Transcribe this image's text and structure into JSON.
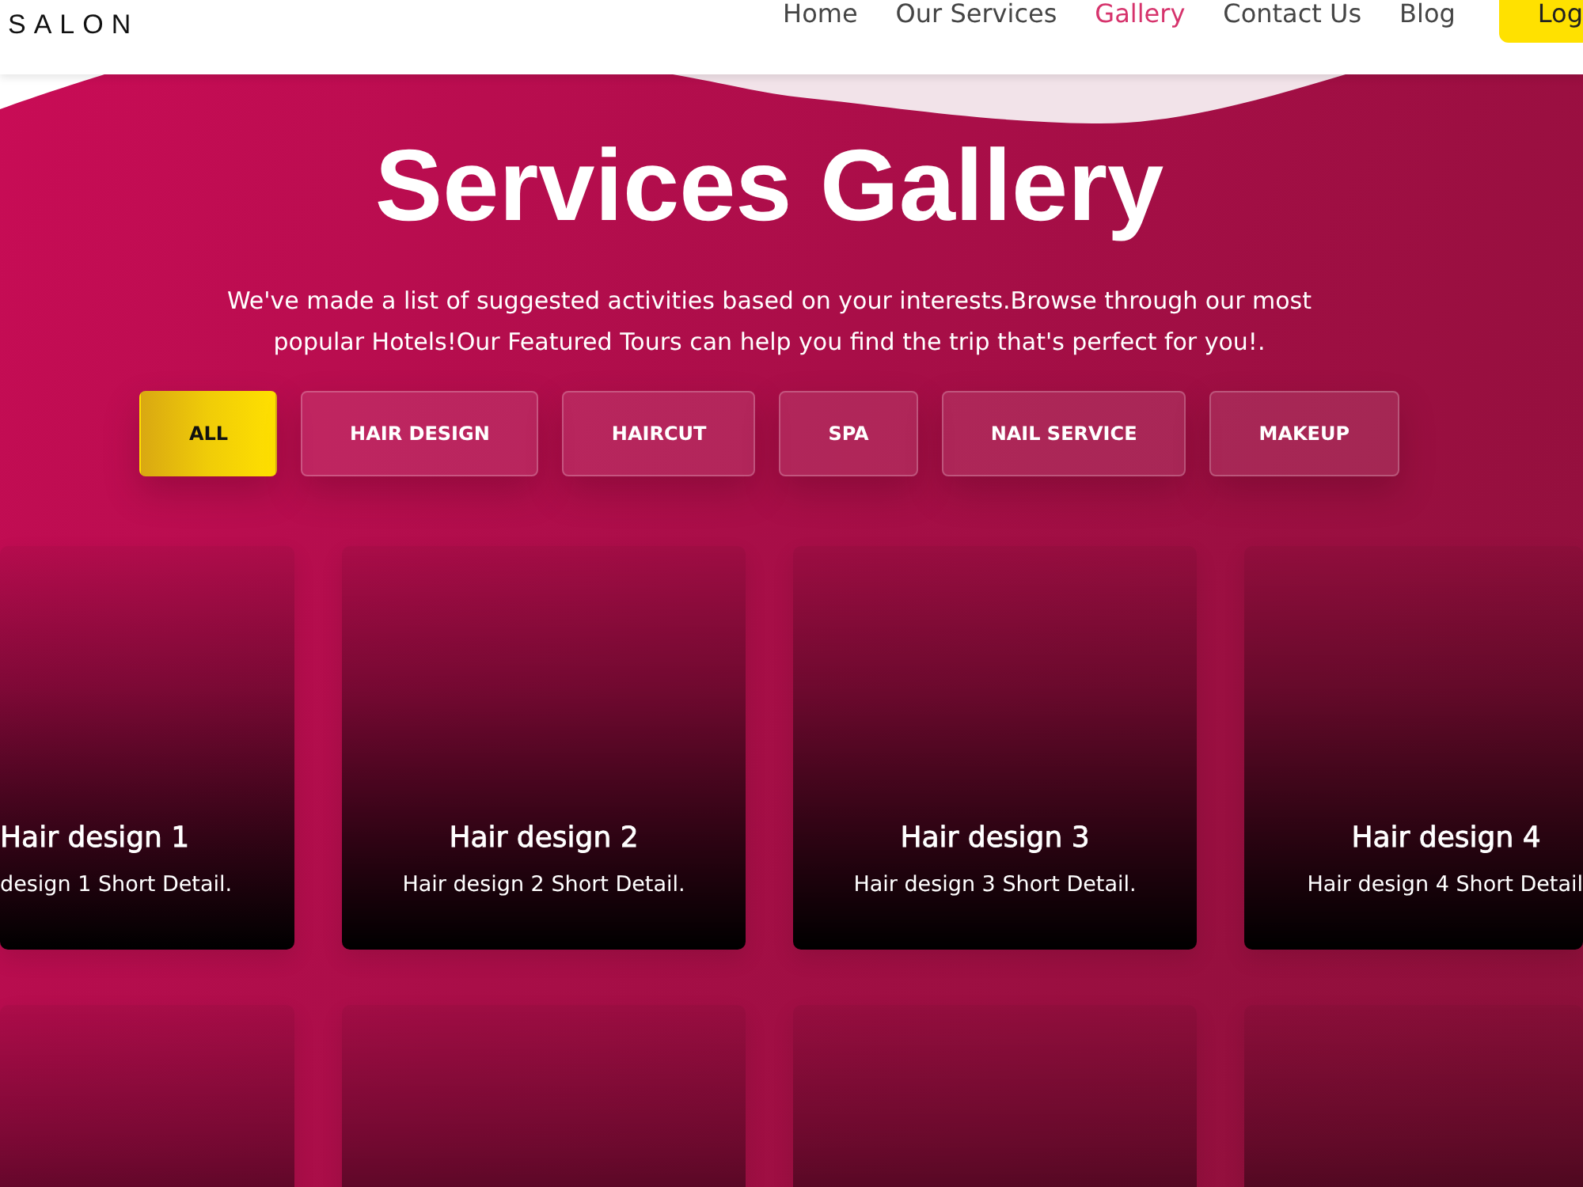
{
  "header": {
    "logo": "SALON",
    "nav": [
      {
        "label": "Home",
        "selected": false
      },
      {
        "label": "Our Services",
        "selected": false
      },
      {
        "label": "Gallery",
        "selected": true
      },
      {
        "label": "Contact Us",
        "selected": false
      },
      {
        "label": "Blog",
        "selected": false
      }
    ],
    "login": "Log"
  },
  "gallery": {
    "title": "Services Gallery",
    "intro": "We've made a list of suggested activities based on your interests.Browse through our most popular Hotels!Our Featured Tours can help you find the trip that's perfect for you!.",
    "filters": [
      {
        "label": "ALL",
        "selected": true
      },
      {
        "label": "HAIR DESIGN",
        "selected": false
      },
      {
        "label": "HAIRCUT",
        "selected": false
      },
      {
        "label": "SPA",
        "selected": false
      },
      {
        "label": "NAIL SERVICE",
        "selected": false
      },
      {
        "label": "MAKEUP",
        "selected": false
      }
    ],
    "cards": [
      {
        "kind": "captioned",
        "title": "Hair design 1",
        "detail": "design 1 Short Detail."
      },
      {
        "kind": "captioned",
        "title": "Hair design 2",
        "detail": "Hair design 2 Short Detail."
      },
      {
        "kind": "captioned",
        "title": "Hair design 3",
        "detail": "Hair design 3 Short Detail."
      },
      {
        "kind": "captioned",
        "title": "Hair design 4",
        "detail": "Hair design 4 Short Detail"
      },
      {
        "kind": "plain"
      },
      {
        "kind": "plain"
      },
      {
        "kind": "plain"
      },
      {
        "kind": "plain"
      }
    ]
  }
}
